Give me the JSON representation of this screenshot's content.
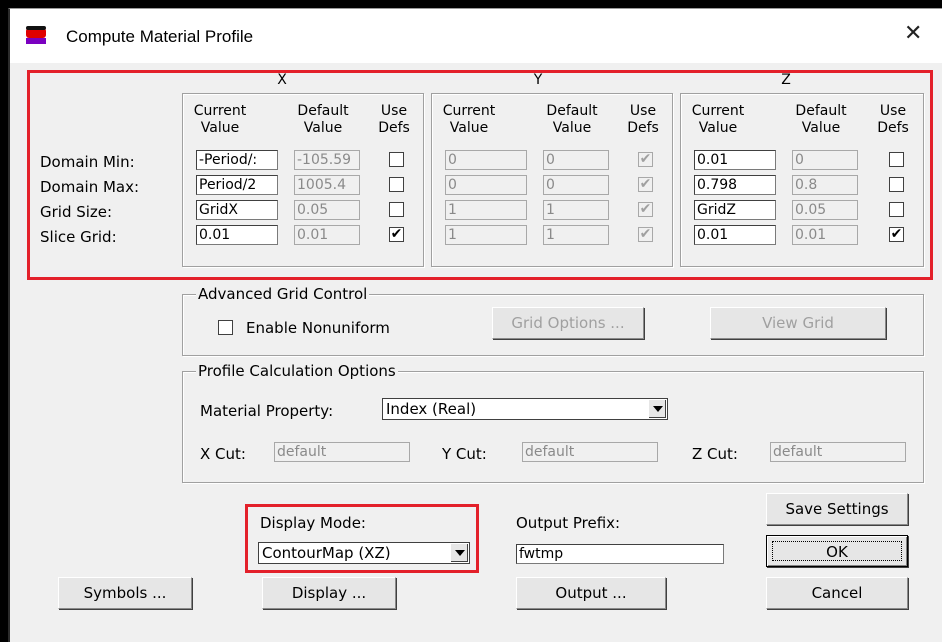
{
  "window": {
    "title": "Compute Material Profile",
    "close_glyph": "✕"
  },
  "domain": {
    "axes": [
      "X",
      "Y",
      "Z"
    ],
    "headers": {
      "current": "Current Value",
      "default": "Default Value",
      "use": "Use Defs"
    },
    "row_labels": [
      "Domain Min:",
      "Domain Max:",
      "Grid Size:",
      "Slice Grid:"
    ],
    "x": {
      "current": [
        "-Period/:",
        "Period/2",
        "GridX",
        "0.01"
      ],
      "default": [
        "-105.59",
        "1005.4",
        "0.05",
        "0.01"
      ],
      "use": [
        false,
        false,
        false,
        true
      ]
    },
    "y": {
      "current": [
        "0",
        "0",
        "1",
        "1"
      ],
      "default": [
        "0",
        "0",
        "1",
        "1"
      ],
      "use": [
        true,
        true,
        true,
        true
      ]
    },
    "z": {
      "current": [
        "0.01",
        "0.798",
        "GridZ",
        "0.01"
      ],
      "default": [
        "0",
        "0.8",
        "0.05",
        "0.01"
      ],
      "use": [
        false,
        false,
        false,
        true
      ]
    }
  },
  "advanced": {
    "title": "Advanced Grid Control",
    "enable_nonuniform": "Enable Nonuniform",
    "grid_options": "Grid Options ...",
    "view_grid": "View Grid"
  },
  "profile": {
    "title": "Profile Calculation Options",
    "material_label": "Material Property:",
    "material_value": "Index (Real)",
    "xcut_label": "X Cut:",
    "xcut_value": "default",
    "ycut_label": "Y Cut:",
    "ycut_value": "default",
    "zcut_label": "Z Cut:",
    "zcut_value": "default"
  },
  "display_mode": {
    "label": "Display Mode:",
    "value": "ContourMap (XZ)"
  },
  "output_prefix": {
    "label": "Output Prefix:",
    "value": "fwtmp"
  },
  "buttons": {
    "save": "Save Settings",
    "ok": "OK",
    "symbols": "Symbols ...",
    "display": "Display ...",
    "output": "Output ...",
    "cancel": "Cancel"
  },
  "icons": {
    "app": "app-window-icon",
    "close": "close-icon"
  },
  "colors": {
    "highlight": "#e3202a"
  }
}
